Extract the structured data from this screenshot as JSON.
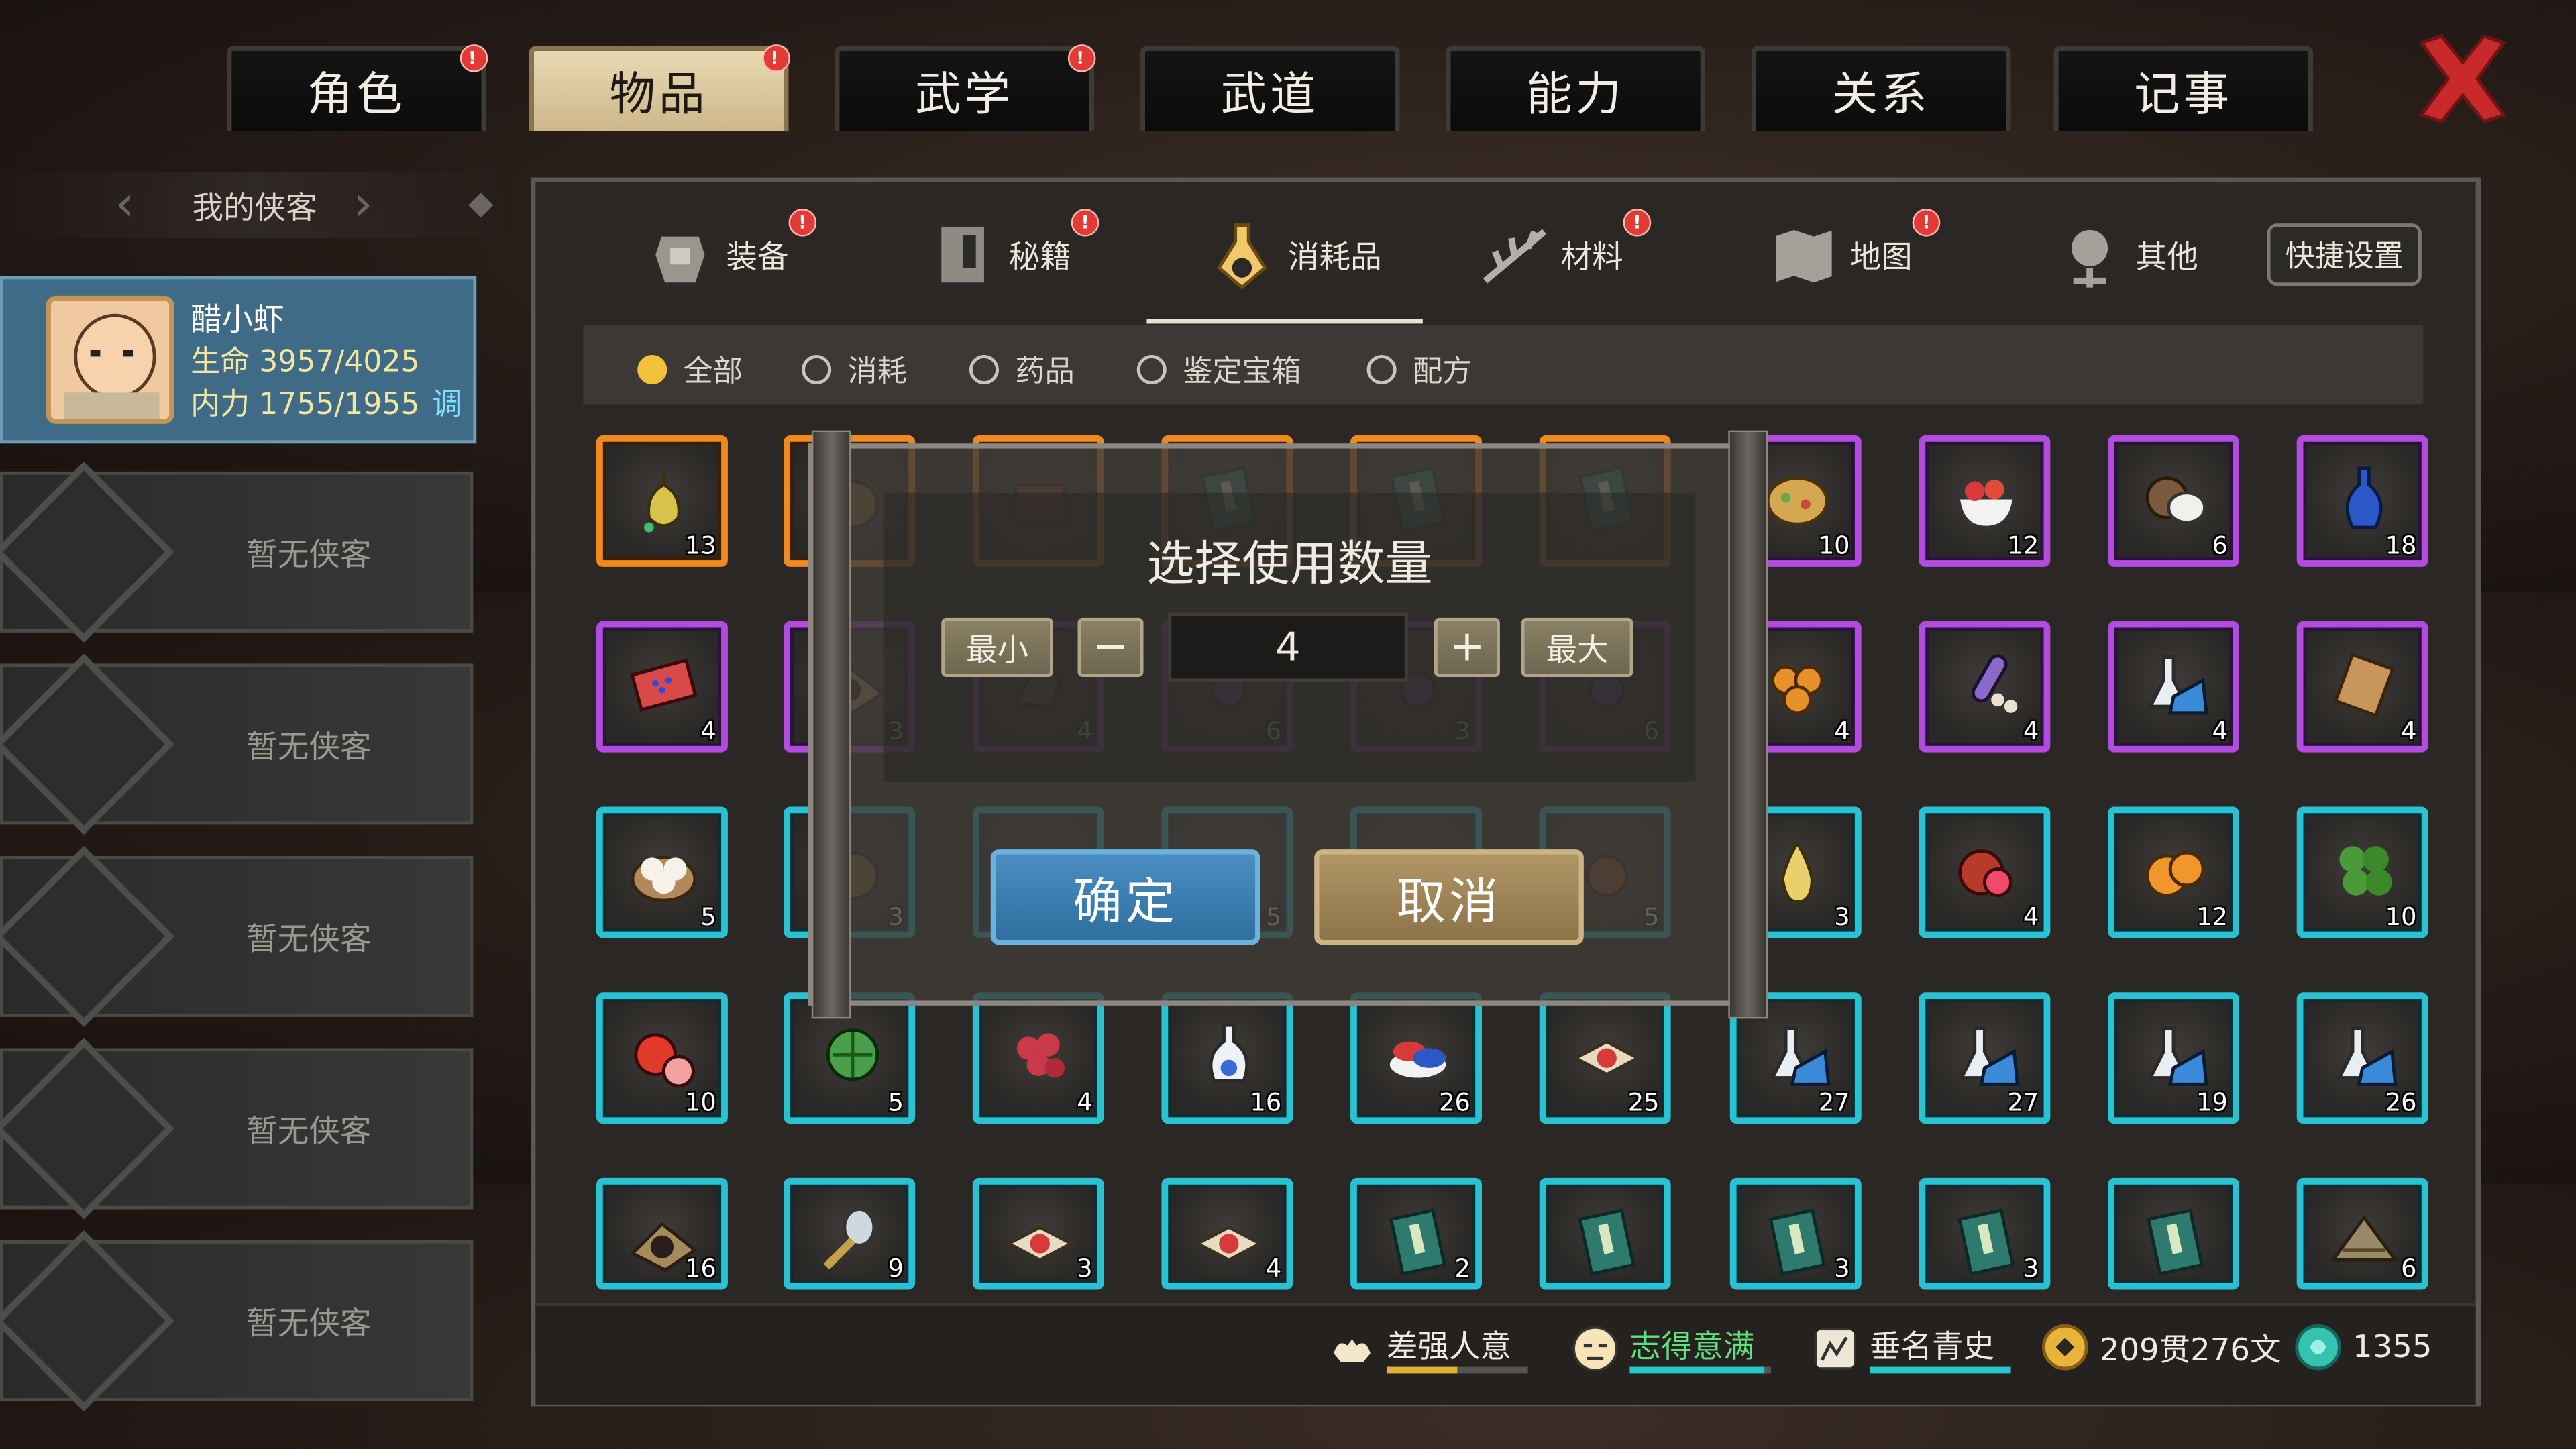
{
  "top_tabs": [
    {
      "label": "角色",
      "badge": true
    },
    {
      "label": "物品",
      "badge": true,
      "active": true
    },
    {
      "label": "武学",
      "badge": true
    },
    {
      "label": "武道",
      "badge": false
    },
    {
      "label": "能力",
      "badge": false
    },
    {
      "label": "关系",
      "badge": false
    },
    {
      "label": "记事",
      "badge": false
    }
  ],
  "sidebar": {
    "title": "我的侠客",
    "hero": {
      "name": "醋小虾",
      "hp": "生命 3957/4025",
      "mp": "内力 1755/1955",
      "mp_action": "调"
    },
    "empty_label": "暂无侠客",
    "empty_count": 5
  },
  "subtabs": [
    {
      "label": "装备",
      "icon": "armor-icon",
      "badge": true
    },
    {
      "label": "秘籍",
      "icon": "book-icon",
      "badge": true
    },
    {
      "label": "消耗品",
      "icon": "potion-icon",
      "badge": false,
      "active": true
    },
    {
      "label": "材料",
      "icon": "herb-icon",
      "badge": true
    },
    {
      "label": "地图",
      "icon": "map-icon",
      "badge": true
    },
    {
      "label": "其他",
      "icon": "other-icon",
      "badge": false
    }
  ],
  "quick_settings": "快捷设置",
  "filters": [
    {
      "label": "全部",
      "selected": true
    },
    {
      "label": "消耗",
      "selected": false
    },
    {
      "label": "药品",
      "selected": false
    },
    {
      "label": "鉴定宝箱",
      "selected": false
    },
    {
      "label": "配方",
      "selected": false
    }
  ],
  "items": [
    [
      {
        "c": "13",
        "r": "orange",
        "art": "gourd"
      },
      {
        "c": "",
        "r": "orange",
        "art": "pot"
      },
      {
        "c": "",
        "r": "orange",
        "art": "box"
      },
      {
        "c": "",
        "r": "orange",
        "art": "book"
      },
      {
        "c": "",
        "r": "orange",
        "art": "book"
      },
      {
        "c": "",
        "r": "orange",
        "art": "book"
      },
      {
        "c": "10",
        "r": "purple",
        "art": "pie"
      },
      {
        "c": "12",
        "r": "purple",
        "art": "bowl"
      },
      {
        "c": "6",
        "r": "purple",
        "art": "coconut"
      },
      {
        "c": "18",
        "r": "purple",
        "art": "vase"
      }
    ],
    [
      {
        "c": "4",
        "r": "purple",
        "art": "mat"
      },
      {
        "c": "3",
        "r": "purple",
        "art": "cloth"
      },
      {
        "c": "4",
        "r": "purple",
        "art": "leaf"
      },
      {
        "c": "6",
        "r": "purple",
        "art": "orb"
      },
      {
        "c": "3",
        "r": "purple",
        "art": "orb"
      },
      {
        "c": "6",
        "r": "purple",
        "art": "orb"
      },
      {
        "c": "4",
        "r": "purple",
        "art": "fruits"
      },
      {
        "c": "4",
        "r": "purple",
        "art": "seeds"
      },
      {
        "c": "4",
        "r": "purple",
        "art": "flask"
      },
      {
        "c": "4",
        "r": "purple",
        "art": "scroll"
      }
    ],
    [
      {
        "c": "5",
        "r": "cyan",
        "art": "buns"
      },
      {
        "c": "3",
        "r": "cyan",
        "art": "pot"
      },
      {
        "c": "",
        "r": "cyan",
        "art": "blank"
      },
      {
        "c": "5",
        "r": "cyan",
        "art": "blank"
      },
      {
        "c": "",
        "r": "cyan",
        "art": "blank"
      },
      {
        "c": "5",
        "r": "cyan",
        "art": "fruit"
      },
      {
        "c": "3",
        "r": "cyan",
        "art": "pear"
      },
      {
        "c": "4",
        "r": "cyan",
        "art": "pomegranate"
      },
      {
        "c": "12",
        "r": "cyan",
        "art": "orange"
      },
      {
        "c": "10",
        "r": "cyan",
        "art": "greens"
      }
    ],
    [
      {
        "c": "10",
        "r": "cyan",
        "art": "tomato"
      },
      {
        "c": "5",
        "r": "cyan",
        "art": "melon"
      },
      {
        "c": "4",
        "r": "cyan",
        "art": "berries"
      },
      {
        "c": "16",
        "r": "cyan",
        "art": "potion"
      },
      {
        "c": "26",
        "r": "cyan",
        "art": "plate"
      },
      {
        "c": "25",
        "r": "cyan",
        "art": "gem"
      },
      {
        "c": "27",
        "r": "cyan",
        "art": "flask"
      },
      {
        "c": "27",
        "r": "cyan",
        "art": "flask"
      },
      {
        "c": "19",
        "r": "cyan",
        "art": "flask"
      },
      {
        "c": "26",
        "r": "cyan",
        "art": "flask"
      }
    ],
    [
      {
        "c": "16",
        "r": "cyan",
        "art": "cloth"
      },
      {
        "c": "9",
        "r": "cyan",
        "art": "spoon"
      },
      {
        "c": "3",
        "r": "cyan",
        "art": "gem"
      },
      {
        "c": "4",
        "r": "cyan",
        "art": "gem"
      },
      {
        "c": "2",
        "r": "cyan",
        "art": "book"
      },
      {
        "c": "",
        "r": "cyan",
        "art": "book"
      },
      {
        "c": "3",
        "r": "cyan",
        "art": "book"
      },
      {
        "c": "3",
        "r": "cyan",
        "art": "book"
      },
      {
        "c": "",
        "r": "cyan",
        "art": "book"
      },
      {
        "c": "6",
        "r": "cyan",
        "art": "hat"
      }
    ]
  ],
  "dialog": {
    "title": "选择使用数量",
    "min_label": "最小",
    "max_label": "最大",
    "minus": "−",
    "plus": "+",
    "quantity": "4",
    "confirm": "确定",
    "cancel": "取消"
  },
  "status": {
    "food": "差强人意",
    "mood": "志得意满",
    "fame": "垂名青史",
    "money": "209贯276文",
    "gems": "1355"
  },
  "colors": {
    "rarity_cyan": "#28c2d3",
    "rarity_purple": "#b24be0",
    "rarity_orange": "#f08a1e",
    "confirm": "#3b82b6",
    "cancel": "#9e8558",
    "badge": "#e23a35"
  }
}
